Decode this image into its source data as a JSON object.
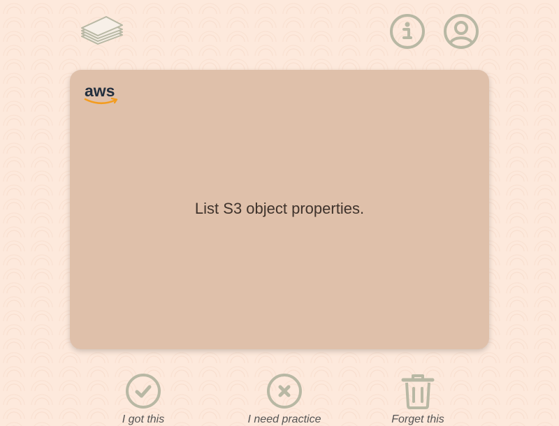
{
  "header": {
    "deck_icon": "card-stack-icon",
    "info_icon": "info-icon",
    "profile_icon": "user-profile-icon"
  },
  "card": {
    "brand_logo_text": "aws",
    "prompt": "List S3 object properties."
  },
  "actions": [
    {
      "icon": "check-circle-icon",
      "label": "I got this"
    },
    {
      "icon": "x-circle-icon",
      "label": "I need practice"
    },
    {
      "icon": "trash-icon",
      "label": "Forget this"
    }
  ],
  "colors": {
    "icon": "#b8b8a4",
    "card": "#dfc0aa",
    "background": "#fde9dc",
    "aws_orange": "#f39c1f"
  }
}
